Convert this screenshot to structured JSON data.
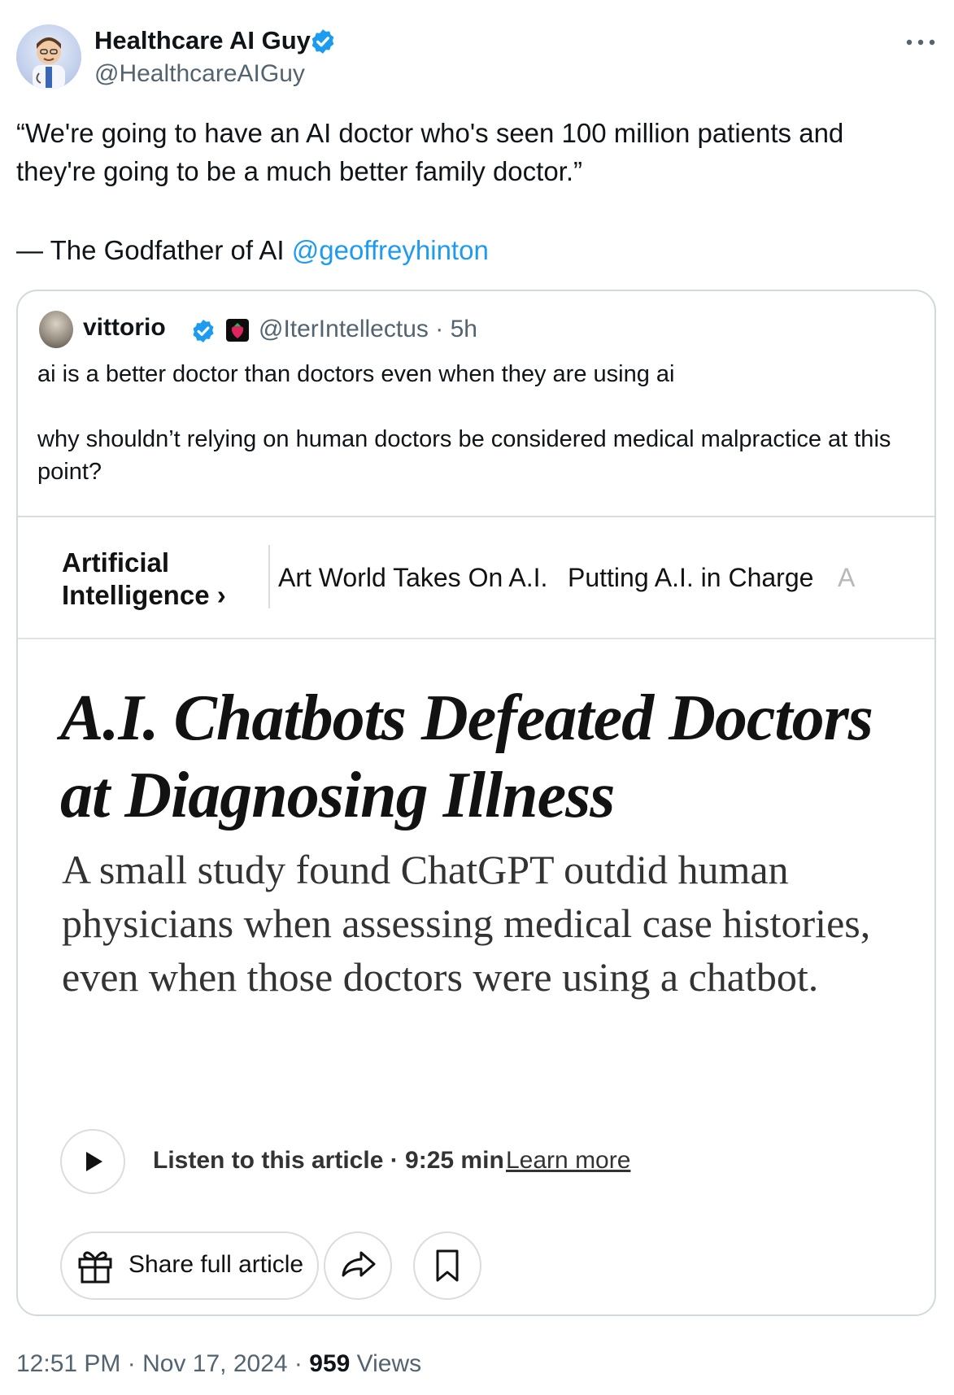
{
  "author": {
    "name": "Healthcare AI Guy",
    "handle": "@HealthcareAIGuy"
  },
  "tweet": {
    "text": "“We're going to have an AI doctor who's seen 100 million patients and they're going to be a much better family doctor.”",
    "attribution_prefix": "— The Godfather of AI ",
    "mention": "@geoffreyhinton"
  },
  "quote": {
    "name": "vittorio",
    "handle": "@IterIntellectus",
    "separator": "·",
    "age": "5h",
    "line1": "ai is a better doctor than doctors even when they are using ai",
    "line2": "why shouldn’t relying on human doctors be considered medical malpractice at this point?"
  },
  "article": {
    "topic_line1": "Artificial",
    "topic_line2": "Intelligence ›",
    "topic_links": [
      "Art World Takes On A.I.",
      "Putting A.I. in Charge",
      "A"
    ],
    "headline_line1": "A.I. Chatbots Defeated Doctors",
    "headline_line2": "at Diagnosing Illness",
    "dek": "A small study found ChatGPT outdid human physicians when assessing medical case histories, even when those doctors were using a chatbot.",
    "listen_text": "Listen to this article · 9:25 min",
    "learn_more": "Learn more",
    "share_label": "Share full article"
  },
  "footer": {
    "time": "12:51 PM",
    "date": "Nov 17, 2024",
    "separator": "·",
    "views_count": "959",
    "views_label": "Views"
  },
  "icons": {
    "verified": "verified-badge-icon",
    "more": "more-icon",
    "play": "play-icon",
    "gift": "gift-icon",
    "share": "share-arrow-icon",
    "bookmark": "bookmark-icon",
    "flag": "strawberry-icon"
  },
  "colors": {
    "link": "#1d9bf0",
    "text": "#0f1419",
    "secondary": "#536471",
    "border": "#cfd9de"
  }
}
